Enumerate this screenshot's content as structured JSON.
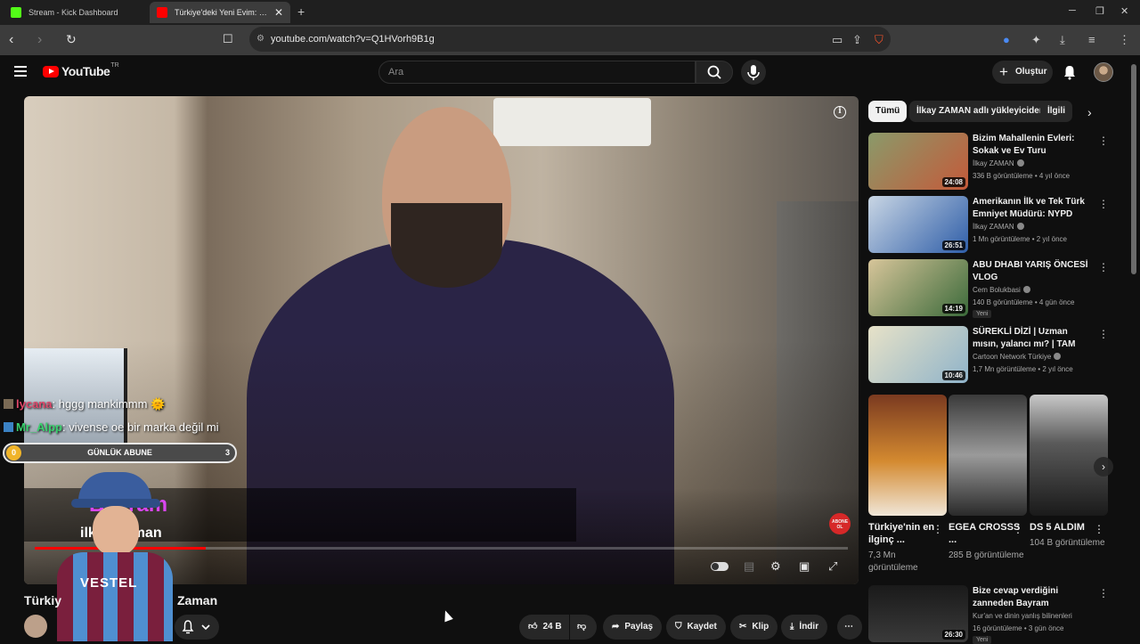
{
  "browser": {
    "tabs": [
      {
        "label": "Stream - Kick Dashboard",
        "favicon_color": "#53fc18"
      },
      {
        "label": "Türkiye'deki Yeni Evim: İlkay Z",
        "favicon_color": "#ff0000"
      }
    ],
    "url": "youtube.com/watch?v=Q1HVorh9B1g"
  },
  "header": {
    "logo_text": "YouTube",
    "country_code": "TR",
    "search_placeholder": "Ara",
    "create_label": "Oluştur"
  },
  "player": {
    "progress_fraction": 0.21,
    "chat": [
      {
        "user": "lycana",
        "user_color": "#e0476a",
        "message": ": hggg mankimmm 🌞"
      },
      {
        "user": "Mr_Alpp",
        "user_color": "#3bd16f",
        "message": ": vivense oe bir marka değil mi"
      }
    ],
    "sub_bar": {
      "coin": "0",
      "label": "GÜNLÜK ABUNE",
      "count": "3"
    },
    "overlay_title": "Bayram",
    "overlay_sub": "ilkay Zaman",
    "kid_shirt_text": "VESTEL",
    "abone_label": "ABONE OL"
  },
  "video": {
    "title_left": "Türkiy",
    "title_right": "Zaman",
    "actions": {
      "like_count": "24 B",
      "share": "Paylaş",
      "save": "Kaydet",
      "clip": "Klip",
      "download": "İndir"
    }
  },
  "sidebar": {
    "chips": [
      {
        "label": "Tümü",
        "active": true
      },
      {
        "label": "İlkay ZAMAN adlı yükleyiciden",
        "active": false
      },
      {
        "label": "İlgili",
        "active": false
      }
    ],
    "recs": [
      {
        "title": "Bizim Mahallenin Evleri: Sokak ve Ev Turu",
        "channel": "İlkay ZAMAN",
        "meta": "336 B görüntüleme • 4 yıl önce",
        "duration": "24:08",
        "new": "",
        "thumb_colors": [
          "#8a9a6a",
          "#c45a3a"
        ]
      },
      {
        "title": "Amerikanın İlk ve Tek Türk Emniyet Müdürü: NYPD",
        "channel": "İlkay ZAMAN",
        "meta": "1 Mn görüntüleme • 2 yıl önce",
        "duration": "26:51",
        "new": "",
        "thumb_colors": [
          "#c9d6e4",
          "#2f5ea8"
        ]
      },
      {
        "title": "ABU DHABI YARIŞ ÖNCESİ VLOG",
        "channel": "Cem Bolukbasi",
        "meta": "140 B görüntüleme • 4 gün önce",
        "duration": "14:19",
        "new": "Yeni",
        "thumb_colors": [
          "#d7c59a",
          "#3b6a3a"
        ]
      },
      {
        "title": "SÜREKLİ DİZİ | Uzman mısın, yalancı mı? | TAM BÖLÜM | ...",
        "channel": "Cartoon Network Türkiye",
        "meta": "1,7 Mn görüntüleme • 2 yıl önce",
        "duration": "10:46",
        "new": "",
        "thumb_colors": [
          "#e7e2c8",
          "#8fb3c9"
        ]
      }
    ],
    "shorts": [
      {
        "title": "Türkiye'nin en ilginç ...",
        "views": "7,3 Mn görüntüleme",
        "thumb_colors": [
          "#7a3a20",
          "#d48a30"
        ]
      },
      {
        "title": "EGEA CROSSS ...",
        "views": "285 B görüntüleme",
        "thumb_colors": [
          "#9a9a9a",
          "#2a2a2a"
        ]
      },
      {
        "title": "DS 5 ALDIM",
        "views": "104 B görüntüleme",
        "thumb_colors": [
          "#5a5a5a",
          "#1a1a1a"
        ]
      }
    ],
    "last_rec": {
      "title": "Bize cevap verdiğini zanneden Bayram Maraşlı'ya reddiye",
      "channel": "Kur'an ve dinin yanlış bilinenleri",
      "meta": "16 görüntüleme • 3 gün önce",
      "duration": "26:30",
      "new": "Yeni"
    }
  }
}
